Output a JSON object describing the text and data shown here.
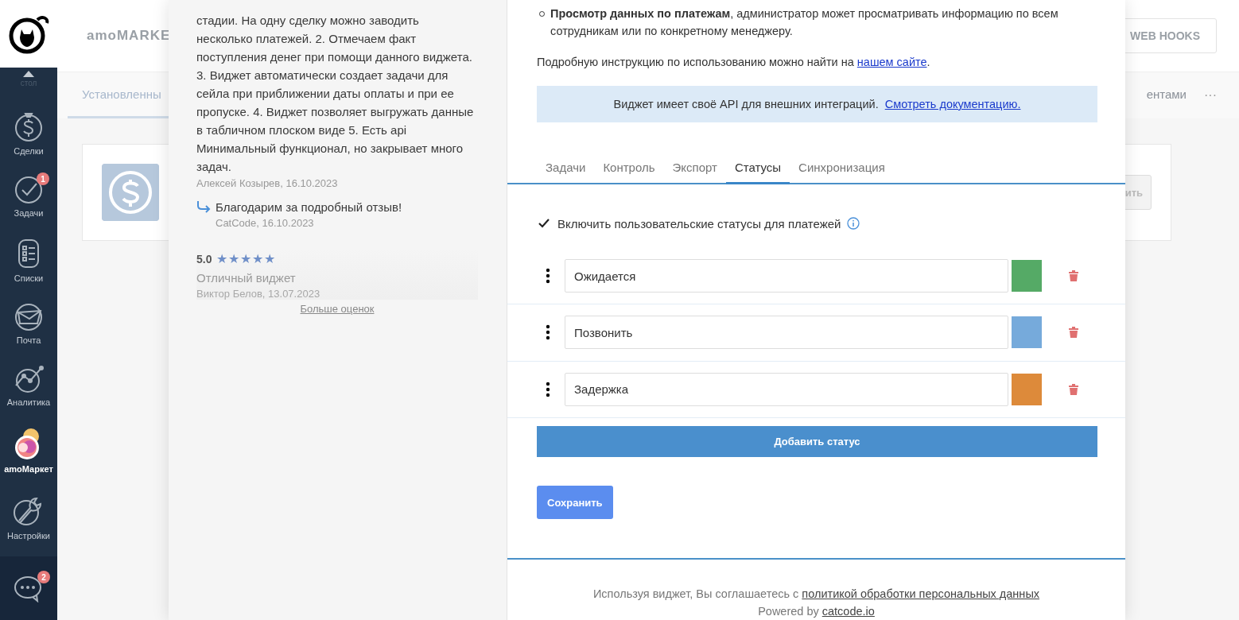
{
  "sidebar": {
    "items": [
      {
        "kind": "desk",
        "label": "стол",
        "selected": false
      },
      {
        "kind": "deals",
        "label": "Сделки",
        "selected": false
      },
      {
        "kind": "tasks",
        "label": "Задачи",
        "badge": "1",
        "selected": false
      },
      {
        "kind": "lists",
        "label": "Списки",
        "selected": false
      },
      {
        "kind": "mail",
        "label": "Почта",
        "selected": false
      },
      {
        "kind": "analytics",
        "label": "Аналитика",
        "selected": false
      },
      {
        "kind": "market",
        "label": "amoМаркет",
        "selected": true
      },
      {
        "kind": "settings",
        "label": "Настройки",
        "selected": false
      }
    ],
    "chat": {
      "badge": "2"
    }
  },
  "background": {
    "title": "amoMARKE",
    "header_button": "WEB HOOKS",
    "tabs": [
      {
        "label": "Установленны",
        "selected": true
      },
      {
        "label": "ентами",
        "selected": false
      }
    ],
    "more": "···",
    "card_button": "ить"
  },
  "reviews": {
    "items": [
      {
        "text": "стадии. На одну сделку можно заводить несколько платежей. 2. Отмечаем факт поступления денег при помощи данного виджета. 3. Виджет автоматически создает задачи для сейла при приближении даты оплаты и при ее пропуске. 4. Виджет позволяет выгружать данные в табличном плоском виде 5. Есть api Минимальный функционал, но закрывает много задач.",
        "author": "Алексей Козырев, 16.10.2023",
        "reply": {
          "text": "Благодарим за подробный отзыв!",
          "author": "CatCode, 16.10.2023"
        }
      },
      {
        "rating": "5.0",
        "stars": 5,
        "text": "Отличный виджет",
        "author": "Виктор Белов, 13.07.2023"
      }
    ],
    "more_link": "Больше оценок"
  },
  "widget": {
    "bullets": [
      "**Просмотр данных по платежам**, администратор может просматривать информацию по всем сотрудникам или по конкретному менеджеру."
    ],
    "instruction": {
      "text": "Подробную инструкцию по использованию можно найти на ",
      "link": "нашем сайте",
      "after": "."
    },
    "api_note": {
      "text": "Виджет имеет своё API для внешних интеграций. ",
      "link": "Смотреть документацию."
    },
    "tabs": [
      {
        "label": "Задачи",
        "selected": false
      },
      {
        "label": "Контроль",
        "selected": false
      },
      {
        "label": "Экспорт",
        "selected": false
      },
      {
        "label": "Статусы",
        "selected": true
      },
      {
        "label": "Синхронизация",
        "selected": false
      }
    ],
    "custom_statuses": {
      "label": "Включить пользовательские статусы для платежей",
      "checked": true
    },
    "statuses": [
      {
        "name": "Ожидается",
        "color": "#55aa66"
      },
      {
        "name": "Позвонить",
        "color": "#76aadb"
      },
      {
        "name": "Задержка",
        "color": "#dd8a3a"
      }
    ],
    "add_button": "Добавить статус",
    "save_button": "Сохранить",
    "footer": {
      "text": "Используя виджет, Вы соглашаетесь с ",
      "link": "политикой обработки персональных данных",
      "powered": "Powered by ",
      "powered_link": "catcode.io"
    }
  }
}
